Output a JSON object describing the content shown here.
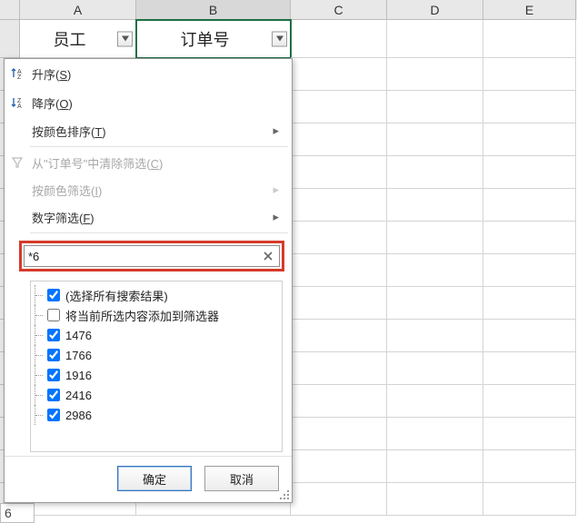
{
  "columns": {
    "A": "A",
    "B": "B",
    "C": "C",
    "D": "D",
    "E": "E"
  },
  "headers": {
    "A": "员工",
    "B": "订单号"
  },
  "dropdown": {
    "sort_asc": "升序(",
    "sort_asc_accel": "S",
    "sort_asc_tail": ")",
    "sort_desc": "降序(",
    "sort_desc_accel": "O",
    "sort_desc_tail": ")",
    "sort_color": "按颜色排序(",
    "sort_color_accel": "T",
    "sort_color_tail": ")",
    "clear_filter": "从\"订单号\"中清除筛选(",
    "clear_filter_accel": "C",
    "clear_filter_tail": ")",
    "filter_color": "按颜色筛选(",
    "filter_color_accel": "I",
    "filter_color_tail": ")",
    "number_filter": "数字筛选(",
    "number_filter_accel": "F",
    "number_filter_tail": ")",
    "search_value": "*6",
    "tree": {
      "select_all": "(选择所有搜索结果)",
      "add_current": "将当前所选内容添加到筛选器",
      "items": [
        "1476",
        "1766",
        "1916",
        "2416",
        "2986"
      ],
      "checked": [
        true,
        false,
        true,
        true,
        true,
        true,
        true
      ]
    },
    "ok": "确定",
    "cancel": "取消"
  },
  "bottom_cell": "6"
}
